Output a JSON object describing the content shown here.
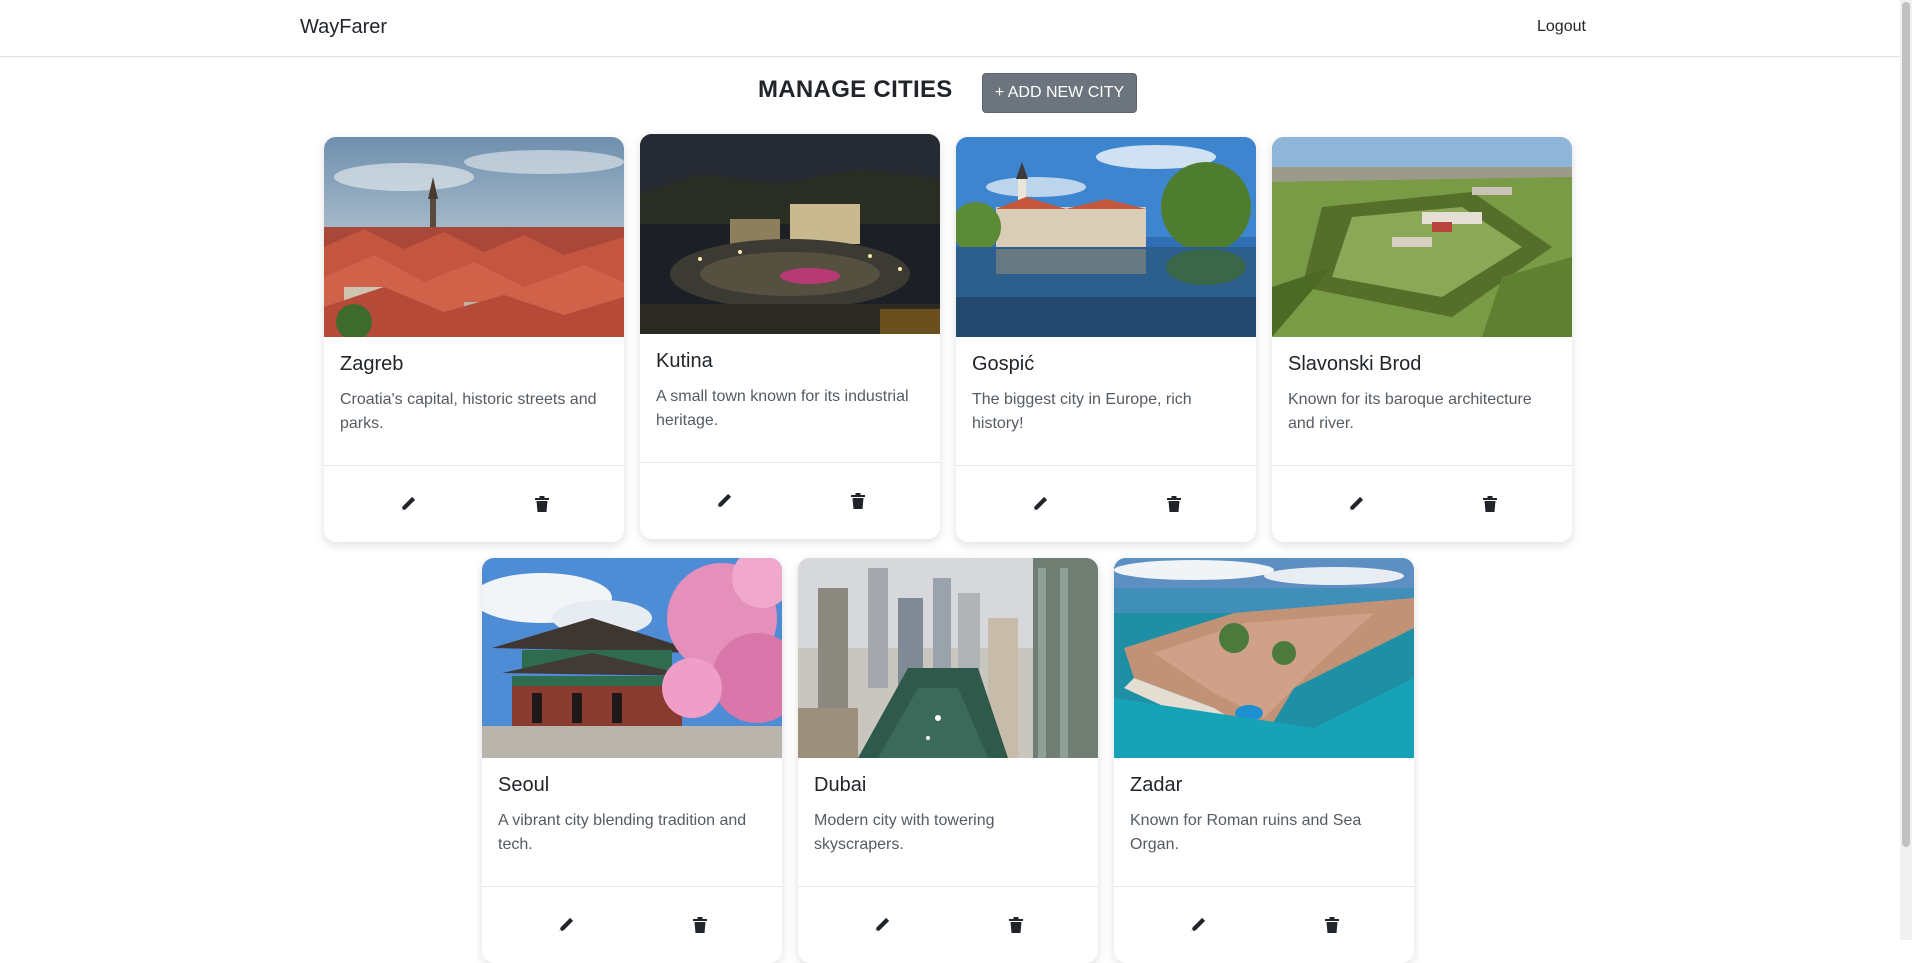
{
  "navbar": {
    "brand": "WayFarer",
    "logout_label": "Logout"
  },
  "main": {
    "title": "MANAGE CITIES",
    "add_button_label": "+ ADD NEW CITY"
  },
  "cities": [
    {
      "name": "Zagreb",
      "description": "Croatia's capital, historic streets and parks.",
      "image": "zagreb-rooftops-photo"
    },
    {
      "name": "Kutina",
      "description": "A small town known for its industrial heritage.",
      "image": "kutina-night-square-photo"
    },
    {
      "name": "Gospić",
      "description": "The biggest city in Europe, rich history!",
      "image": "gospic-river-church-photo"
    },
    {
      "name": "Slavonski Brod",
      "description": "Known for its baroque architecture and river.",
      "image": "slavonski-brod-fortress-photo"
    },
    {
      "name": "Seoul",
      "description": "A vibrant city blending tradition and tech.",
      "image": "seoul-palace-blossoms-photo"
    },
    {
      "name": "Dubai",
      "description": "Modern city with towering skyscrapers.",
      "image": "dubai-marina-skyscrapers-photo"
    },
    {
      "name": "Zadar",
      "description": "Known for Roman ruins and Sea Organ.",
      "image": "zadar-peninsula-sea-photo"
    }
  ],
  "icons": {
    "edit": "pencil-icon",
    "delete": "trash-icon"
  }
}
